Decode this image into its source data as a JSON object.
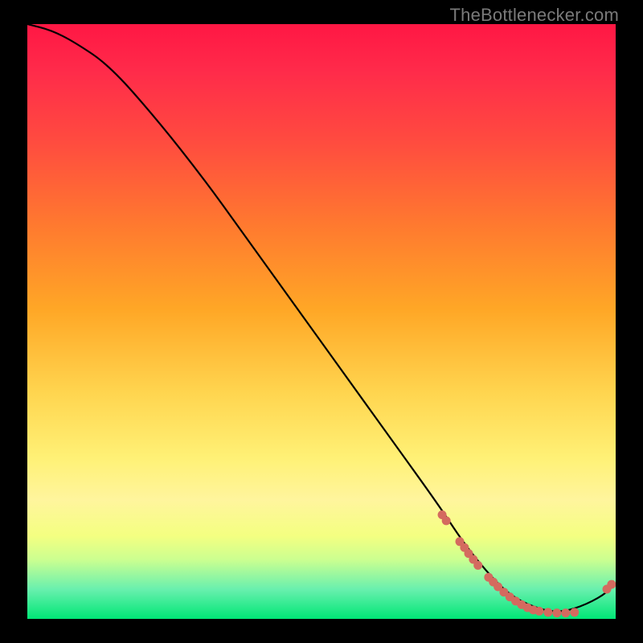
{
  "attribution": "TheBottlenecker.com",
  "colors": {
    "curve": "#000000",
    "dot": "#d46a5f",
    "gradient_top": "#ff1744",
    "gradient_bottom": "#00e676"
  },
  "chart_data": {
    "type": "line",
    "title": "",
    "xlabel": "",
    "ylabel": "",
    "xlim": [
      0,
      100
    ],
    "ylim": [
      0,
      100
    ],
    "curve": {
      "x": [
        0,
        4,
        8,
        14,
        22,
        30,
        38,
        46,
        54,
        62,
        70,
        74,
        78,
        82,
        86,
        90,
        94,
        98,
        100
      ],
      "y": [
        100,
        99,
        97,
        93,
        84,
        74,
        63,
        52,
        41,
        30,
        19,
        13,
        8,
        4,
        2,
        1,
        2,
        4,
        6
      ]
    },
    "series": [
      {
        "name": "markers",
        "x": [
          70.5,
          71.2,
          73.5,
          74.3,
          75.0,
          75.8,
          76.6,
          78.4,
          79.2,
          80.0,
          81.0,
          82.0,
          83.0,
          84.0,
          85.0,
          86.0,
          87.0,
          88.5,
          90.0,
          91.5,
          93.0,
          98.5,
          99.3
        ],
        "y": [
          17.5,
          16.5,
          13.0,
          12.0,
          11.0,
          10.0,
          9.0,
          7.0,
          6.2,
          5.4,
          4.5,
          3.7,
          3.0,
          2.4,
          1.9,
          1.5,
          1.3,
          1.1,
          1.0,
          1.0,
          1.1,
          5.0,
          5.8
        ]
      }
    ]
  }
}
